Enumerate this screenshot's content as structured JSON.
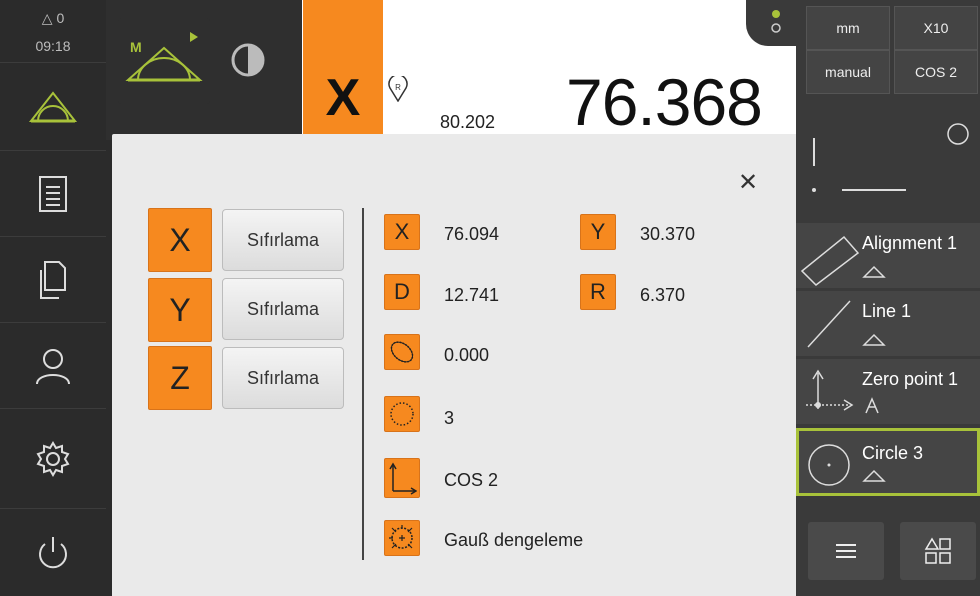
{
  "status": {
    "warnings": "0",
    "time": "09:18"
  },
  "top": {
    "axis": "X",
    "nominal": "80.202",
    "value": "76.368"
  },
  "toolbar": {
    "unit": "mm",
    "zoom": "X10",
    "mode": "manual",
    "coord_system": "COS 2"
  },
  "features": [
    {
      "label": "Alignment 1"
    },
    {
      "label": "Line 1"
    },
    {
      "label": "Zero point 1"
    },
    {
      "label": "Circle 3"
    }
  ],
  "dialog": {
    "axes": [
      {
        "axis": "X",
        "reset_label": "Sıfırlama"
      },
      {
        "axis": "Y",
        "reset_label": "Sıfırlama"
      },
      {
        "axis": "Z",
        "reset_label": "Sıfırlama"
      }
    ],
    "results": {
      "x_label": "X",
      "x": "76.094",
      "y_label": "Y",
      "y": "30.370",
      "d_label": "D",
      "d": "12.741",
      "r_label": "R",
      "r": "6.370",
      "form": "0.000",
      "points": "3",
      "coord_system": "COS 2",
      "fit": "Gauß dengeleme"
    }
  },
  "colors": {
    "accent": "#f6891f",
    "selected": "#a8c23a",
    "dark": "#2b2b2b"
  }
}
